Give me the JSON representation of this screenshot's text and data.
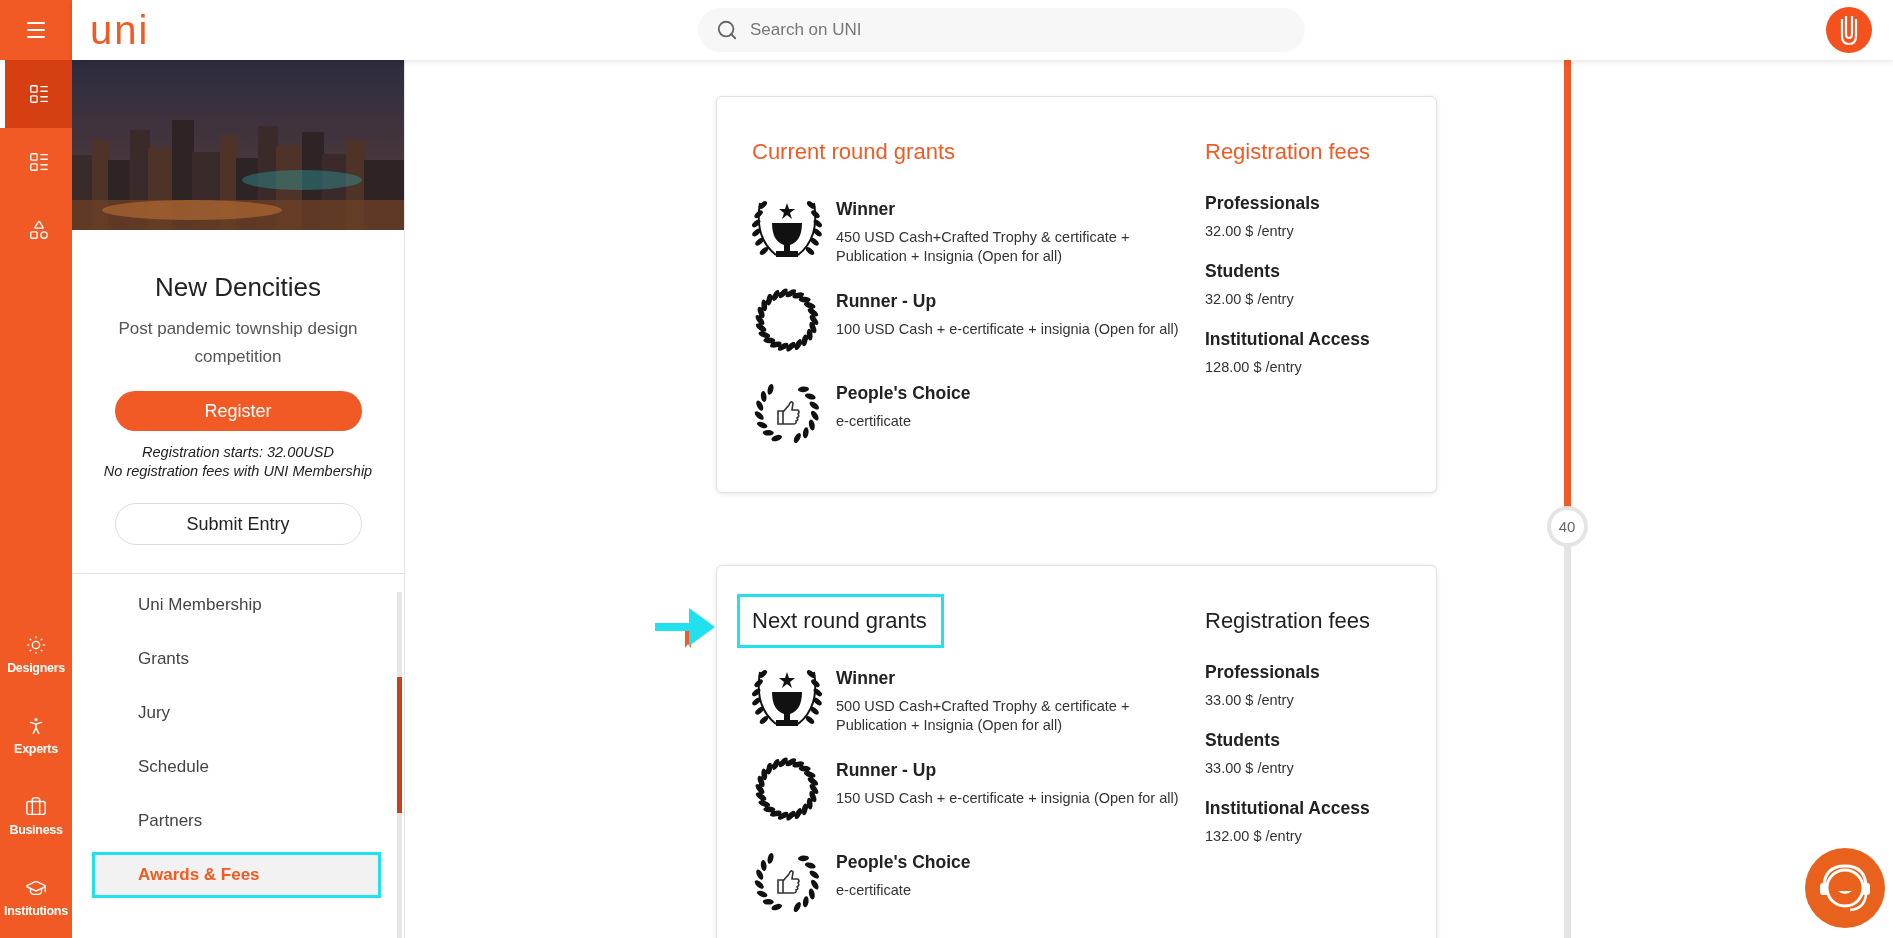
{
  "header": {
    "logo": "uni",
    "search": {
      "placeholder": "Search on UNI"
    }
  },
  "rail": {
    "top_items": [
      {
        "selected": true
      },
      {
        "selected": false
      },
      {
        "selected": false
      }
    ],
    "bottom_items": [
      {
        "label": "Designers"
      },
      {
        "label": "Experts"
      },
      {
        "label": "Business"
      },
      {
        "label": "Institutions"
      }
    ]
  },
  "competition": {
    "title": "New Dencities",
    "subtitle": "Post pandemic township design competition",
    "register_button": "Register",
    "notes": [
      "Registration starts: 32.00USD",
      "No registration fees with UNI Membership"
    ],
    "submit_button": "Submit Entry"
  },
  "nav": [
    {
      "label": "Uni Membership",
      "selected": false,
      "highlighted": false
    },
    {
      "label": "Grants",
      "selected": false,
      "highlighted": false
    },
    {
      "label": "Jury",
      "selected": false,
      "highlighted": false
    },
    {
      "label": "Schedule",
      "selected": false,
      "highlighted": false
    },
    {
      "label": "Partners",
      "selected": false,
      "highlighted": false
    },
    {
      "label": "Awards & Fees",
      "selected": true,
      "highlighted": true
    }
  ],
  "cards": [
    {
      "title": "Current round grants",
      "active": true,
      "highlighted": false,
      "fees_title": "Registration fees",
      "grants": [
        {
          "kind": "winner",
          "name": "Winner",
          "description": "450 USD Cash+Crafted Trophy & certificate + Publication + Insignia (Open for all)"
        },
        {
          "kind": "runner",
          "name": "Runner - Up",
          "description": "100 USD Cash + e-certificate + insignia (Open for all)"
        },
        {
          "kind": "choice",
          "name": "People's Choice",
          "description": "e-certificate"
        }
      ],
      "fees": [
        {
          "name": "Professionals",
          "price": "32.00 $ /entry"
        },
        {
          "name": "Students",
          "price": "32.00 $ /entry"
        },
        {
          "name": "Institutional Access",
          "price": "128.00 $ /entry"
        }
      ]
    },
    {
      "title": "Next round grants",
      "active": false,
      "highlighted": true,
      "fees_title": "Registration fees",
      "grants": [
        {
          "kind": "winner",
          "name": "Winner",
          "description": "500 USD Cash+Crafted Trophy & certificate + Publication + Insignia (Open for all)"
        },
        {
          "kind": "runner",
          "name": "Runner - Up",
          "description": "150 USD Cash + e-certificate + insignia (Open for all)"
        },
        {
          "kind": "choice",
          "name": "People's Choice",
          "description": "e-certificate"
        }
      ],
      "fees": [
        {
          "name": "Professionals",
          "price": "33.00 $ /entry"
        },
        {
          "name": "Students",
          "price": "33.00 $ /entry"
        },
        {
          "name": "Institutional Access",
          "price": "132.00 $ /entry"
        }
      ]
    }
  ],
  "timeline": {
    "marker": "40",
    "level": 0.51
  }
}
